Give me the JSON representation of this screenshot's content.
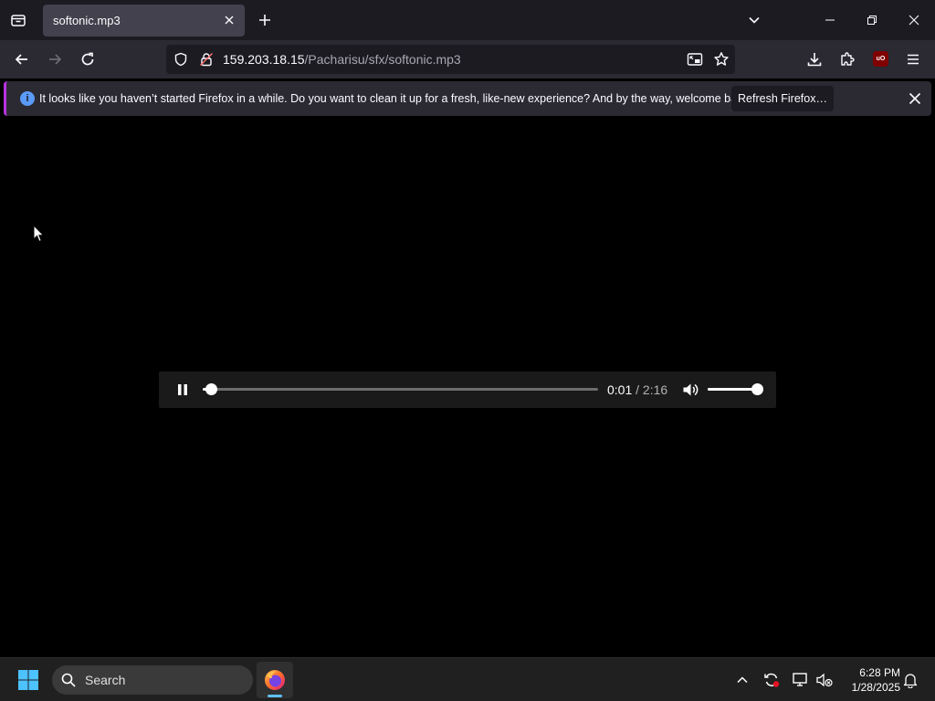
{
  "browser": {
    "tab": {
      "title": "softonic.mp3"
    },
    "url": {
      "host": "159.203.18.15",
      "path": "/Pacharisu/sfx/softonic.mp3"
    },
    "extension_badge": "uO"
  },
  "notification": {
    "message": "It looks like you haven’t started Firefox in a while. Do you want to clean it up for a fresh, like-new experience? And by the way, welcome back!",
    "button_label": "Refresh Firefox…",
    "accent_color": "#b833e1"
  },
  "player": {
    "state": "playing",
    "current_time": "0:01",
    "duration": "2:16",
    "duration_separator": " / ",
    "progress_percent": 2,
    "volume_percent": 100
  },
  "taskbar": {
    "search_label": "Search",
    "clock": {
      "time": "6:28 PM",
      "date": "1/28/2025"
    }
  }
}
